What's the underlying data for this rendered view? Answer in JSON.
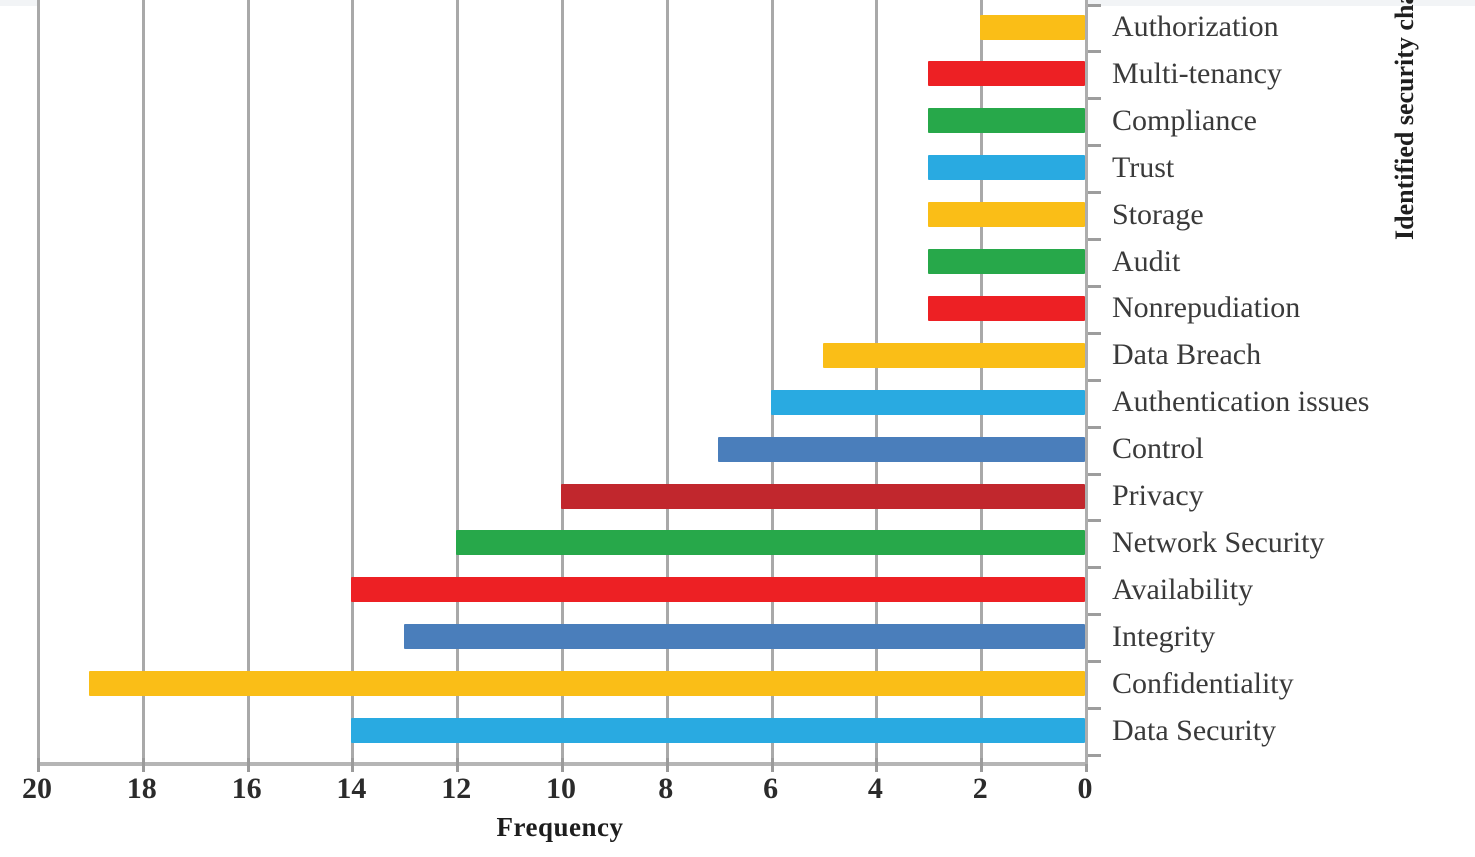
{
  "chart_data": {
    "type": "bar",
    "orientation": "horizontal",
    "title": "",
    "xlabel": "Frequency",
    "ylabel": "Identified security challenges",
    "xlim": [
      20,
      0
    ],
    "x_axis_reversed": true,
    "xticks": [
      20,
      18,
      16,
      14,
      12,
      10,
      8,
      6,
      4,
      2,
      0
    ],
    "grid": "vertical",
    "legend": "none",
    "categories": [
      "Authorization",
      "Multi-tenancy",
      "Compliance",
      "Trust",
      "Storage",
      "Audit",
      "Nonrepudiation",
      "Data Breach",
      "Authentication issues",
      "Control",
      "Privacy",
      "Network Security",
      "Availability",
      "Integrity",
      "Confidentiality",
      "Data Security"
    ],
    "values": [
      2,
      3,
      3,
      3,
      3,
      3,
      3,
      5,
      6,
      7,
      10,
      12,
      14,
      13,
      19,
      14
    ],
    "colors": [
      "#FABE17",
      "#ED2024",
      "#27A84A",
      "#29AAE1",
      "#FABE17",
      "#27A84A",
      "#ED2024",
      "#FABE17",
      "#29AAE1",
      "#4A7EBB",
      "#C1272D",
      "#27A84A",
      "#ED2024",
      "#4A7EBB",
      "#FABE17",
      "#29AAE1"
    ]
  },
  "axes": {
    "x_title": "Frequency",
    "y_title": "Identified security challenges",
    "x_tick_labels": [
      "20",
      "18",
      "16",
      "14",
      "12",
      "10",
      "8",
      "6",
      "4",
      "2",
      "0"
    ]
  },
  "palette": {
    "amber": "#FABE17",
    "red": "#ED2024",
    "green": "#27A84A",
    "sky": "#29AAE1",
    "steel_blue": "#4A7EBB",
    "dark_red": "#C1272D",
    "gridline": "#a9a9a9",
    "axis": "#adadad",
    "text": "#2b2b2b",
    "background": "#ffffff"
  }
}
